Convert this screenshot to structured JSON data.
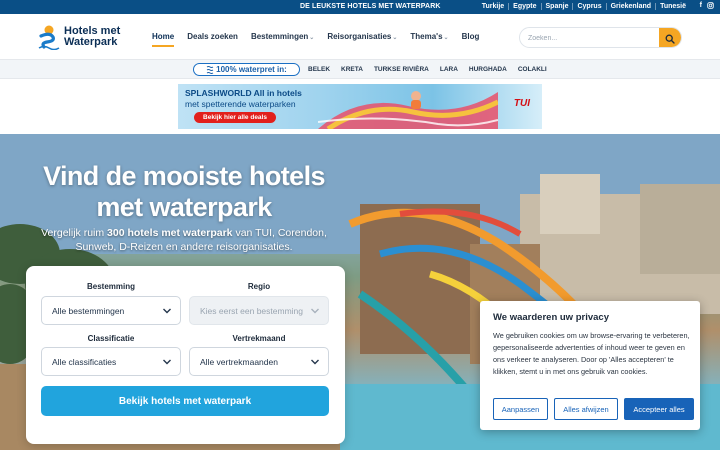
{
  "topbar": {
    "promo": "DE LEUKSTE HOTELS MET WATERPARK",
    "countries": [
      "Turkije",
      "Egypte",
      "Spanje",
      "Cyprus",
      "Griekenland",
      "Tunesië"
    ]
  },
  "header": {
    "logo_text": "Hotels met Waterpark",
    "nav": [
      {
        "label": "Home",
        "active": true,
        "dropdown": false
      },
      {
        "label": "Deals zoeken",
        "active": false,
        "dropdown": false
      },
      {
        "label": "Bestemmingen",
        "active": false,
        "dropdown": true
      },
      {
        "label": "Reisorganisaties",
        "active": false,
        "dropdown": true
      },
      {
        "label": "Thema's",
        "active": false,
        "dropdown": true
      },
      {
        "label": "Blog",
        "active": false,
        "dropdown": false
      }
    ],
    "search_placeholder": "Zoeken..."
  },
  "strip": {
    "pill_label": "100% waterpret in:",
    "destinations": [
      "BELEK",
      "KRETA",
      "TURKSE RIVIÈRA",
      "LARA",
      "HURGHADA",
      "COLAKLI"
    ]
  },
  "banner": {
    "brand": "SPLASHWORLD",
    "title_rest": "All in hotels",
    "subtitle": "met spetterende waterparken",
    "cta": "Bekijk hier alle deals",
    "partner": "TUI"
  },
  "hero": {
    "title": "Vind de mooiste hotels met waterpark",
    "lead_pre": "Vergelijk ruim ",
    "lead_bold": "300 hotels met waterpark",
    "lead_post": " van TUI, Corendon, Sunweb, D-Reizen en andere reisorganisaties."
  },
  "form": {
    "destination_label": "Bestemming",
    "destination_value": "Alle bestemmingen",
    "region_label": "Regio",
    "region_value": "Kies eerst een bestemming",
    "classification_label": "Classificatie",
    "classification_value": "Alle classificaties",
    "month_label": "Vertrekmaand",
    "month_value": "Alle vertrekmaanden",
    "submit": "Bekijk hotels met waterpark"
  },
  "cookie": {
    "title": "We waarderen uw privacy",
    "text": "We gebruiken cookies om uw browse-ervaring te verbeteren, gepersonaliseerde advertenties of inhoud weer te geven en ons verkeer te analyseren. Door op 'Alles accepteren' te klikken, stemt u in met ons gebruik van cookies.",
    "customize": "Aanpassen",
    "reject": "Alles afwijzen",
    "accept": "Accepteer alles"
  },
  "colors": {
    "topbar": "#0a4f86",
    "accent_orange": "#f5a623",
    "button_blue": "#21a4dd",
    "cookie_blue": "#1863b8"
  }
}
